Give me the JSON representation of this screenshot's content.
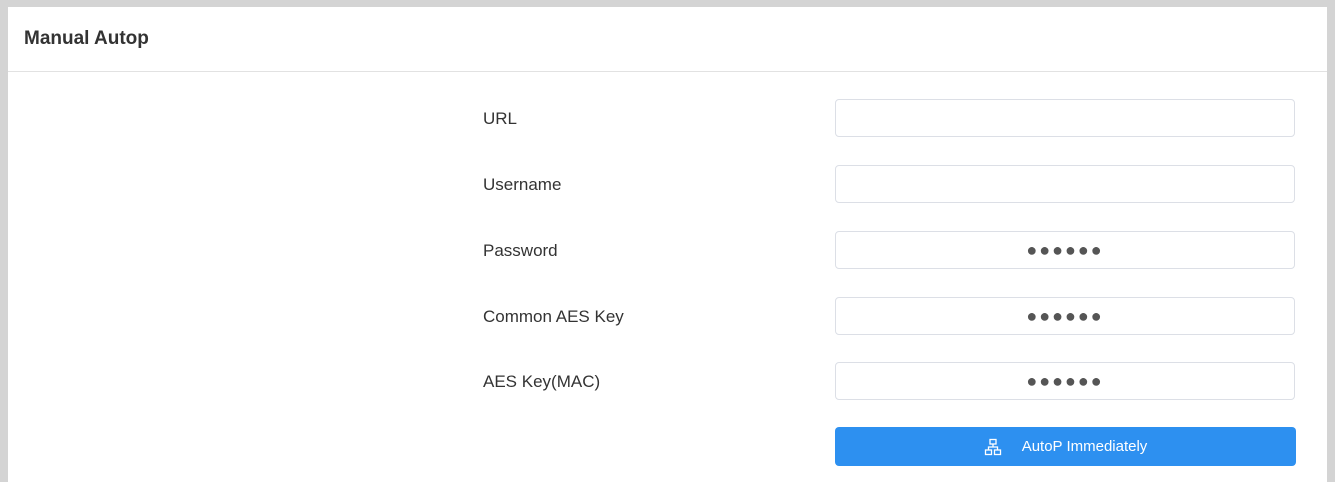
{
  "panel": {
    "title": "Manual Autop"
  },
  "form": {
    "url": {
      "label": "URL",
      "value": ""
    },
    "username": {
      "label": "Username",
      "value": ""
    },
    "password": {
      "label": "Password",
      "value": "●●●●●●"
    },
    "common_aes_key": {
      "label": "Common AES Key",
      "value": "●●●●●●"
    },
    "aes_key_mac": {
      "label": "AES Key(MAC)",
      "value": "●●●●●●"
    }
  },
  "actions": {
    "autop_button": {
      "label": "AutoP Immediately",
      "icon": "network-icon"
    }
  },
  "colors": {
    "primary": "#2d90f0",
    "background": "#d4d4d4"
  }
}
